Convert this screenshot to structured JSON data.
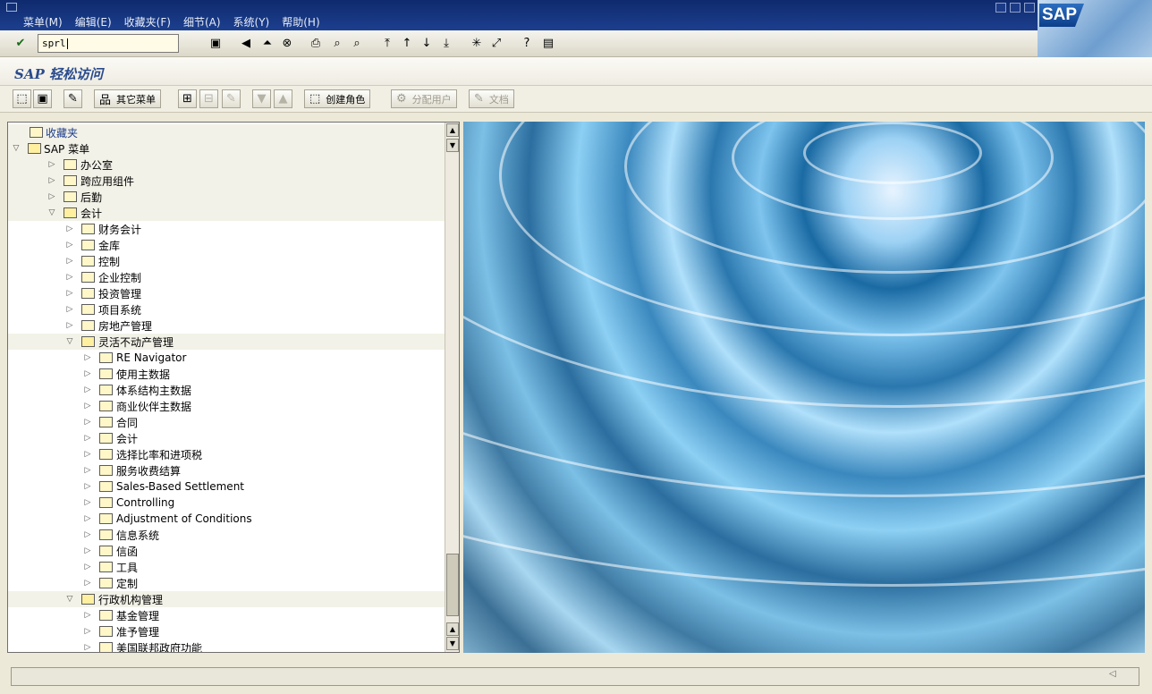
{
  "menubar": {
    "items": [
      "菜单(M)",
      "编辑(E)",
      "收藏夹(F)",
      "细节(A)",
      "系统(Y)",
      "帮助(H)"
    ],
    "logo_text": "SAP"
  },
  "std_toolbar": {
    "command_value": "sprl",
    "icons": [
      "enter-icon",
      "save-icon",
      "back-icon",
      "exit-icon",
      "cancel-icon",
      "print-icon",
      "find-icon",
      "find-next-icon",
      "first-page-icon",
      "prev-page-icon",
      "next-page-icon",
      "last-page-icon",
      "new-session-icon",
      "shortcut-icon",
      "help-icon",
      "layout-icon"
    ]
  },
  "page": {
    "title": "SAP 轻松访问"
  },
  "app_toolbar": {
    "other_menu": "其它菜单",
    "create_role": "创建角色",
    "assign_users": "分配用户",
    "documentation": "文档"
  },
  "tree": {
    "favorites": "收藏夹",
    "sap_menu": "SAP 菜单",
    "items": [
      {
        "label": "办公室",
        "level": 1,
        "open": false
      },
      {
        "label": "跨应用组件",
        "level": 1,
        "open": false
      },
      {
        "label": "后勤",
        "level": 1,
        "open": false
      },
      {
        "label": "会计",
        "level": 1,
        "open": true
      },
      {
        "label": "财务会计",
        "level": 2,
        "open": false
      },
      {
        "label": "金库",
        "level": 2,
        "open": false
      },
      {
        "label": "控制",
        "level": 2,
        "open": false
      },
      {
        "label": "企业控制",
        "level": 2,
        "open": false
      },
      {
        "label": "投资管理",
        "level": 2,
        "open": false
      },
      {
        "label": "项目系统",
        "level": 2,
        "open": false
      },
      {
        "label": "房地产管理",
        "level": 2,
        "open": false
      },
      {
        "label": "灵活不动产管理",
        "level": 2,
        "open": true
      },
      {
        "label": "RE Navigator",
        "level": 3,
        "open": false
      },
      {
        "label": "使用主数据",
        "level": 3,
        "open": false
      },
      {
        "label": "体系结构主数据",
        "level": 3,
        "open": false
      },
      {
        "label": "商业伙伴主数据",
        "level": 3,
        "open": false
      },
      {
        "label": "合同",
        "level": 3,
        "open": false
      },
      {
        "label": "会计",
        "level": 3,
        "open": false
      },
      {
        "label": "选择比率和进项税",
        "level": 3,
        "open": false
      },
      {
        "label": "服务收费结算",
        "level": 3,
        "open": false
      },
      {
        "label": "Sales-Based Settlement",
        "level": 3,
        "open": false
      },
      {
        "label": "Controlling",
        "level": 3,
        "open": false
      },
      {
        "label": "Adjustment of Conditions",
        "level": 3,
        "open": false
      },
      {
        "label": "信息系统",
        "level": 3,
        "open": false
      },
      {
        "label": "信函",
        "level": 3,
        "open": false
      },
      {
        "label": "工具",
        "level": 3,
        "open": false
      },
      {
        "label": "定制",
        "level": 3,
        "open": false
      },
      {
        "label": "行政机构管理",
        "level": 2,
        "open": true
      },
      {
        "label": "基金管理",
        "level": 3,
        "open": false
      },
      {
        "label": "准予管理",
        "level": 3,
        "open": false
      },
      {
        "label": "美国联邦政府功能",
        "level": 3,
        "open": false
      }
    ]
  },
  "colors": {
    "menubar": "#0f2a6e",
    "title": "#2a4b8d",
    "tree_alt": "#f3f2e8"
  }
}
